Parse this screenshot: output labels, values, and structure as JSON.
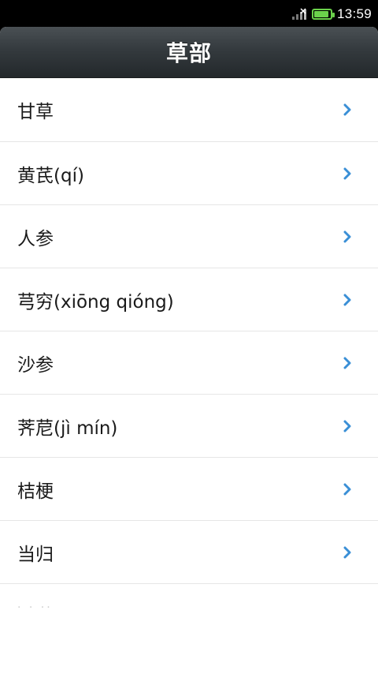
{
  "status_bar": {
    "time": "13:59",
    "battery_color": "#6bd14b",
    "battery_level": 0.9,
    "icons": [
      "signal-icon",
      "battery-icon"
    ]
  },
  "header": {
    "title": "草部"
  },
  "list": {
    "items": [
      {
        "label": "甘草"
      },
      {
        "label": "黄芪(qí)"
      },
      {
        "label": "人参"
      },
      {
        "label": "芎穷(xiōng qióng)"
      },
      {
        "label": "沙参"
      },
      {
        "label": "荠苨(jì mín)"
      },
      {
        "label": "桔梗"
      },
      {
        "label": "当归"
      }
    ],
    "chevron_color": "#3a8fd6",
    "partial_item_text": "· · ··"
  }
}
